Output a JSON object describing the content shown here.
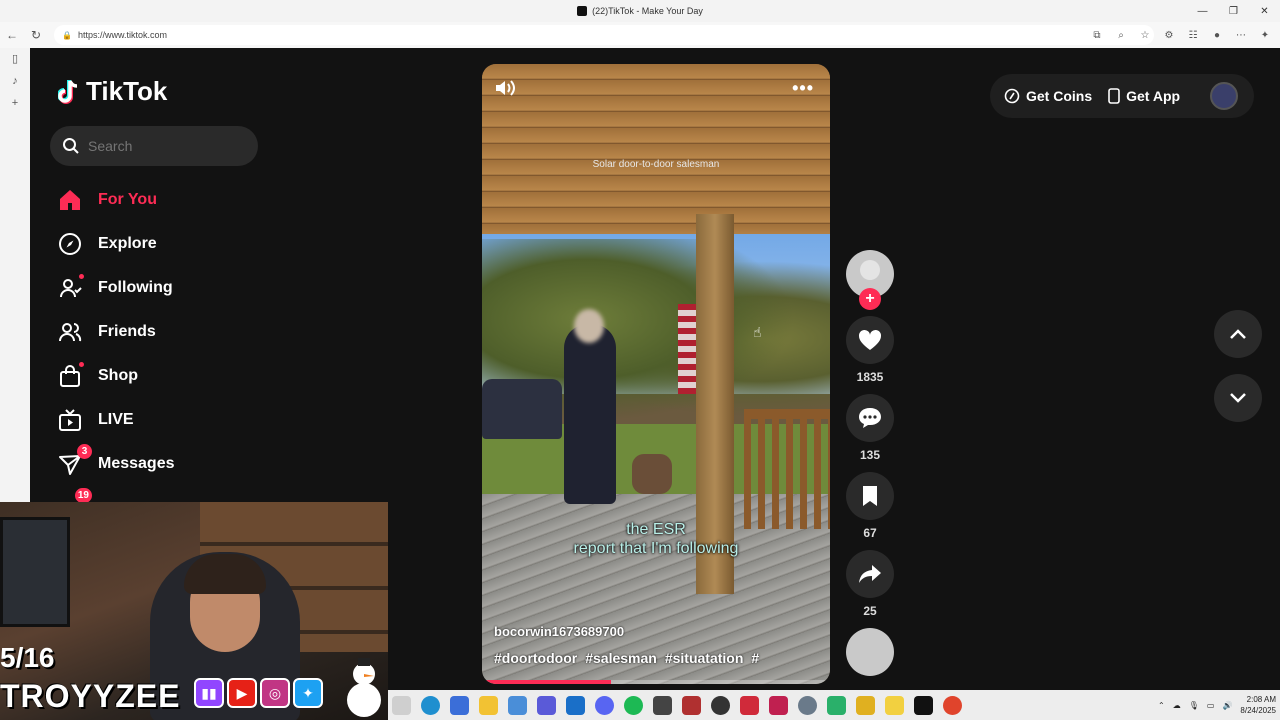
{
  "browser": {
    "title": "(22)TikTok - Make Your Day",
    "url": "https://www.tiktok.com",
    "controls": [
      "—",
      "❐",
      "✕"
    ]
  },
  "sidebar": {
    "logo": "TikTok",
    "search_placeholder": "Search",
    "items": [
      {
        "label": "For You",
        "icon": "home-icon",
        "active": true
      },
      {
        "label": "Explore",
        "icon": "compass-icon"
      },
      {
        "label": "Following",
        "icon": "following-icon",
        "dot": true
      },
      {
        "label": "Friends",
        "icon": "friends-icon"
      },
      {
        "label": "Shop",
        "icon": "shop-icon",
        "dot": true
      },
      {
        "label": "LIVE",
        "icon": "live-icon"
      },
      {
        "label": "Messages",
        "icon": "messages-icon",
        "badge": "3"
      }
    ],
    "activity_badge": "19"
  },
  "video": {
    "top_text": "Solar door-to-door salesman",
    "caption_line1": "the ESR",
    "caption_line2": "report that I'm following",
    "username": "bocorwin1673689700",
    "tags": [
      "#doortodoor",
      "#salesman",
      "#situatation",
      "#"
    ],
    "more": "•••",
    "progress": 0.37
  },
  "actions": {
    "likes": "1835",
    "comments": "135",
    "saves": "67",
    "shares": "25"
  },
  "header": {
    "get_coins": "Get Coins",
    "get_app": "Get App"
  },
  "webcam": {
    "count": "5/16",
    "name": "TROYYZEE"
  },
  "taskbar": {
    "time": "2:08 AM",
    "date": "8/24/2025"
  },
  "colors": {
    "accent": "#fe2c55",
    "background": "#121212"
  }
}
